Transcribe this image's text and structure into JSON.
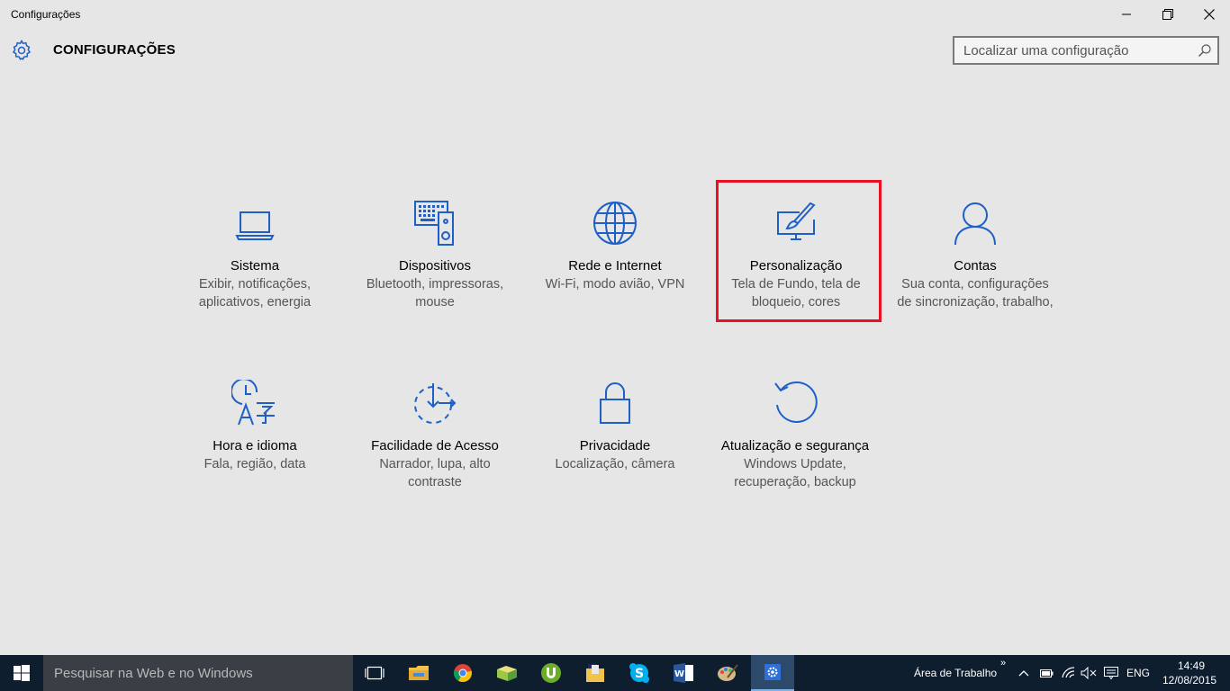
{
  "window": {
    "title": "Configurações"
  },
  "header": {
    "title": "CONFIGURAÇÕES",
    "search_placeholder": "Localizar uma configuração"
  },
  "tiles": [
    {
      "title": "Sistema",
      "desc": "Exibir, notificações, aplicativos, energia",
      "icon": "laptop-icon"
    },
    {
      "title": "Dispositivos",
      "desc": "Bluetooth, impressoras, mouse",
      "icon": "devices-icon"
    },
    {
      "title": "Rede e Internet",
      "desc": "Wi-Fi, modo avião, VPN",
      "icon": "globe-icon"
    },
    {
      "title": "Personalização",
      "desc": "Tela de Fundo, tela de bloqueio, cores",
      "icon": "paint-brush-icon"
    },
    {
      "title": "Contas",
      "desc": "Sua conta, configurações de sincronização, trabalho,",
      "icon": "person-icon"
    },
    {
      "title": "Hora e idioma",
      "desc": "Fala, região, data",
      "icon": "time-language-icon"
    },
    {
      "title": "Facilidade de Acesso",
      "desc": "Narrador, lupa, alto contraste",
      "icon": "ease-of-access-icon"
    },
    {
      "title": "Privacidade",
      "desc": "Localização, câmera",
      "icon": "lock-icon"
    },
    {
      "title": "Atualização e segurança",
      "desc": "Windows Update, recuperação, backup",
      "icon": "update-icon"
    }
  ],
  "taskbar": {
    "search_placeholder": "Pesquisar na Web e no Windows",
    "desktop_label": "Área de Trabalho",
    "language": "ENG",
    "time": "14:49",
    "date": "12/08/2015"
  },
  "colors": {
    "accent": "#1e5fc8",
    "highlight": "#e81123",
    "taskbar": "#0e1e2f"
  }
}
